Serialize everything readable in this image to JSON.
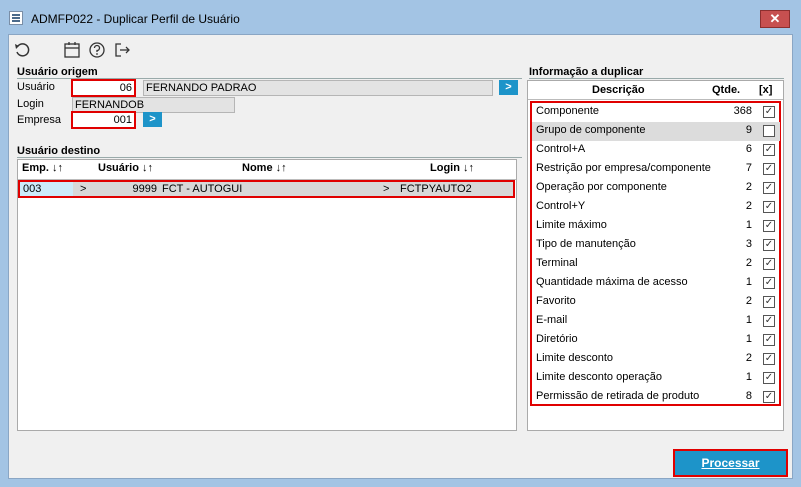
{
  "window": {
    "title": "ADMFP022 - Duplicar Perfil de Usuário",
    "close_glyph": "✕"
  },
  "toolbar": {
    "icons": [
      "undo-icon",
      "calendar-icon",
      "help-icon",
      "exit-icon"
    ]
  },
  "origem": {
    "section_title": "Usuário origem",
    "usuario_label": "Usuário",
    "usuario_code": "06",
    "usuario_name": "FERNANDO PADRAO",
    "login_label": "Login",
    "login_value": "FERNANDOB",
    "empresa_label": "Empresa",
    "empresa_value": "001",
    "arrow_glyph": ">"
  },
  "destino": {
    "section_title": "Usuário destino",
    "headers": {
      "emp": "Emp. ↓↑",
      "usuario": "Usuário ↓↑",
      "nome": "Nome ↓↑",
      "login": "Login ↓↑"
    },
    "row": {
      "emp": "003",
      "sel1": ">",
      "usuario": "9999",
      "nome": "FCT - AUTOGUI",
      "sel2": ">",
      "login": "FCTPYAUTO2"
    }
  },
  "informacao": {
    "section_title": "Informação a duplicar",
    "headers": {
      "descricao": "Descrição",
      "qtde": "Qtde.",
      "check": "[x]"
    },
    "check_glyph": "✓",
    "rows": [
      {
        "descricao": "Componente",
        "qtde": "368",
        "checked": true
      },
      {
        "descricao": "Grupo de componente",
        "qtde": "9",
        "checked": false
      },
      {
        "descricao": "Control+A",
        "qtde": "6",
        "checked": true
      },
      {
        "descricao": "Restrição por empresa/componente",
        "qtde": "7",
        "checked": true
      },
      {
        "descricao": "Operação por componente",
        "qtde": "2",
        "checked": true
      },
      {
        "descricao": "Control+Y",
        "qtde": "2",
        "checked": true
      },
      {
        "descricao": "Limite máximo",
        "qtde": "1",
        "checked": true
      },
      {
        "descricao": "Tipo de manutenção",
        "qtde": "3",
        "checked": true
      },
      {
        "descricao": "Terminal",
        "qtde": "2",
        "checked": true
      },
      {
        "descricao": "Quantidade máxima de acesso",
        "qtde": "1",
        "checked": true
      },
      {
        "descricao": "Favorito",
        "qtde": "2",
        "checked": true
      },
      {
        "descricao": "E-mail",
        "qtde": "1",
        "checked": true
      },
      {
        "descricao": "Diretório",
        "qtde": "1",
        "checked": true
      },
      {
        "descricao": "Limite desconto",
        "qtde": "2",
        "checked": true
      },
      {
        "descricao": "Limite desconto operação",
        "qtde": "1",
        "checked": true
      },
      {
        "descricao": "Permissão de retirada de produto",
        "qtde": "8",
        "checked": true
      }
    ]
  },
  "actions": {
    "processar_label": "Processar"
  },
  "colors": {
    "accent": "#1d94c9",
    "highlight": "#e00000",
    "frame": "#a3c4e4"
  }
}
